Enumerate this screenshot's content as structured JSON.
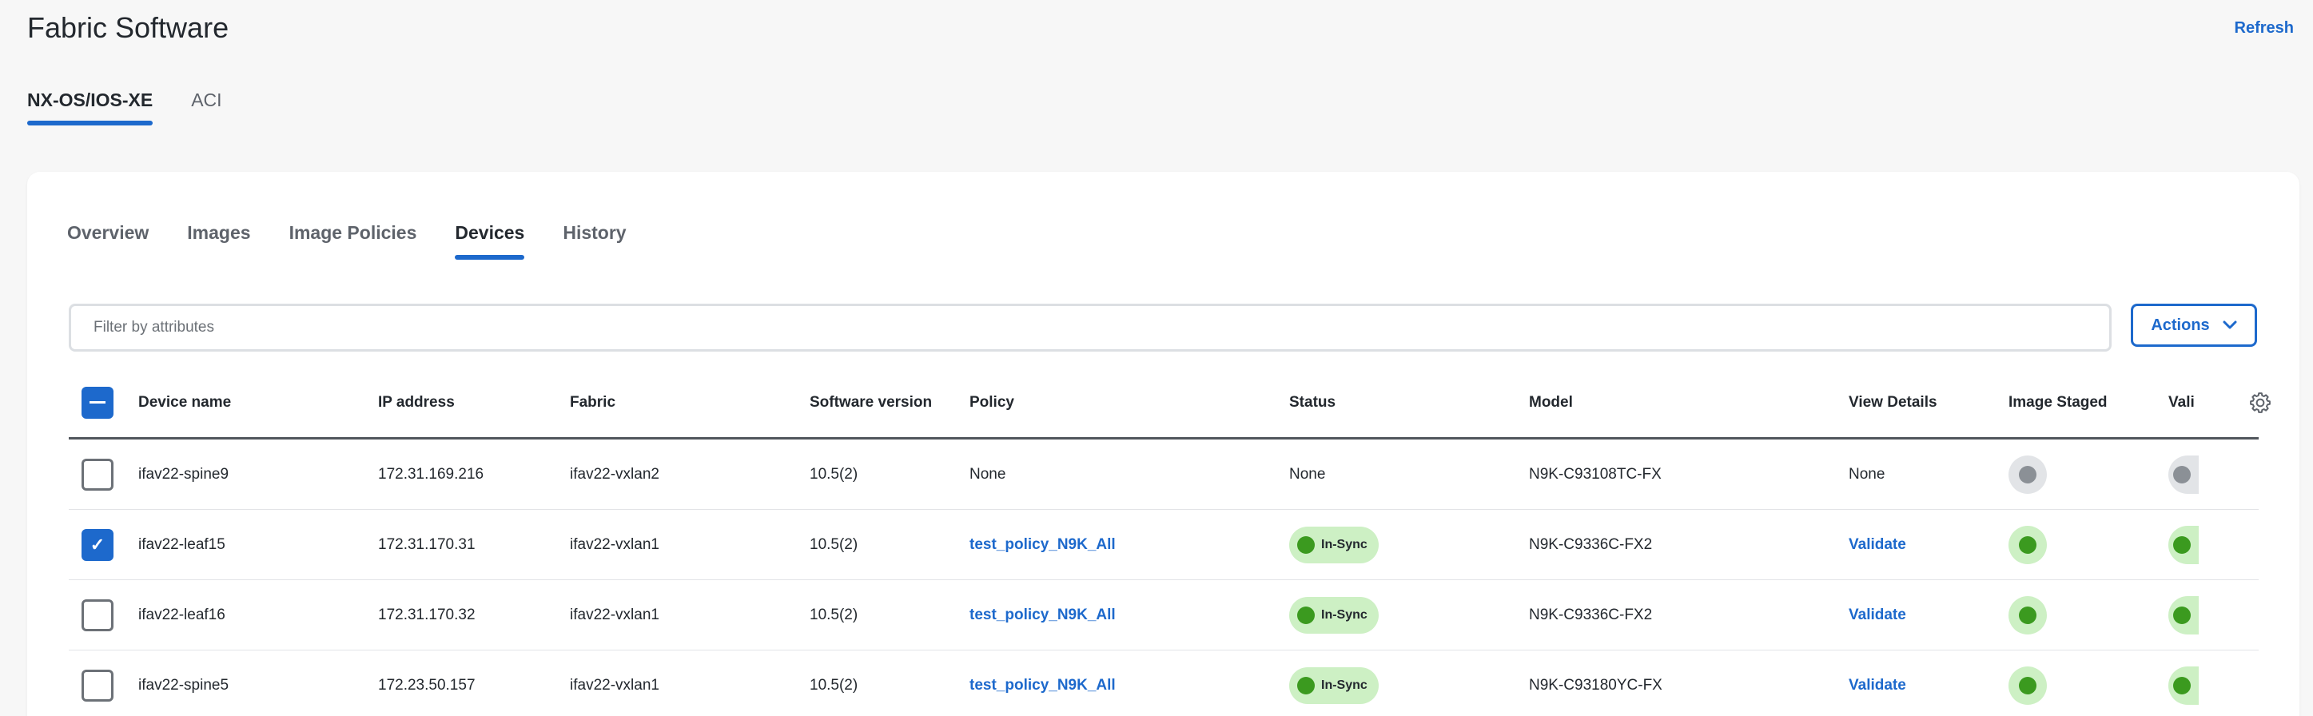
{
  "page": {
    "title": "Fabric Software",
    "refresh_label": "Refresh"
  },
  "top_tabs": [
    {
      "label": "NX-OS/IOS-XE",
      "active": true
    },
    {
      "label": "ACI",
      "active": false
    }
  ],
  "sub_tabs": [
    {
      "label": "Overview",
      "active": false
    },
    {
      "label": "Images",
      "active": false
    },
    {
      "label": "Image Policies",
      "active": false
    },
    {
      "label": "Devices",
      "active": true
    },
    {
      "label": "History",
      "active": false
    }
  ],
  "filter": {
    "placeholder": "Filter by attributes"
  },
  "actions": {
    "label": "Actions",
    "icon": "chevron-down-icon"
  },
  "table": {
    "columns": [
      "Device name",
      "IP address",
      "Fabric",
      "Software version",
      "Policy",
      "Status",
      "Model",
      "View Details",
      "Image Staged",
      "Vali"
    ],
    "settings_icon": "gear-icon",
    "header_checkbox_state": "partial",
    "rows": [
      {
        "checked": false,
        "device": "ifav22-spine9",
        "ip": "172.31.169.216",
        "fabric": "ifav22-vxlan2",
        "version": "10.5(2)",
        "policy": "None",
        "policy_link": false,
        "status": "None",
        "status_badge": false,
        "model": "N9K-C93108TC-FX",
        "details": "None",
        "details_link": false,
        "staged": "gray",
        "validated": "gray"
      },
      {
        "checked": true,
        "device": "ifav22-leaf15",
        "ip": "172.31.170.31",
        "fabric": "ifav22-vxlan1",
        "version": "10.5(2)",
        "policy": "test_policy_N9K_All",
        "policy_link": true,
        "status": "In-Sync",
        "status_badge": true,
        "model": "N9K-C9336C-FX2",
        "details": "Validate",
        "details_link": true,
        "staged": "green",
        "validated": "green"
      },
      {
        "checked": false,
        "device": "ifav22-leaf16",
        "ip": "172.31.170.32",
        "fabric": "ifav22-vxlan1",
        "version": "10.5(2)",
        "policy": "test_policy_N9K_All",
        "policy_link": true,
        "status": "In-Sync",
        "status_badge": true,
        "model": "N9K-C9336C-FX2",
        "details": "Validate",
        "details_link": true,
        "staged": "green",
        "validated": "green"
      },
      {
        "checked": false,
        "device": "ifav22-spine5",
        "ip": "172.23.50.157",
        "fabric": "ifav22-vxlan1",
        "version": "10.5(2)",
        "policy": "test_policy_N9K_All",
        "policy_link": true,
        "status": "In-Sync",
        "status_badge": true,
        "model": "N9K-C93180YC-FX",
        "details": "Validate",
        "details_link": true,
        "staged": "green",
        "validated": "green"
      }
    ]
  },
  "colors": {
    "accent": "#1d69cc",
    "status_green": "#3b9a1f",
    "status_green_bg": "#cdf0c4",
    "neutral_dot": "#8b9096"
  }
}
